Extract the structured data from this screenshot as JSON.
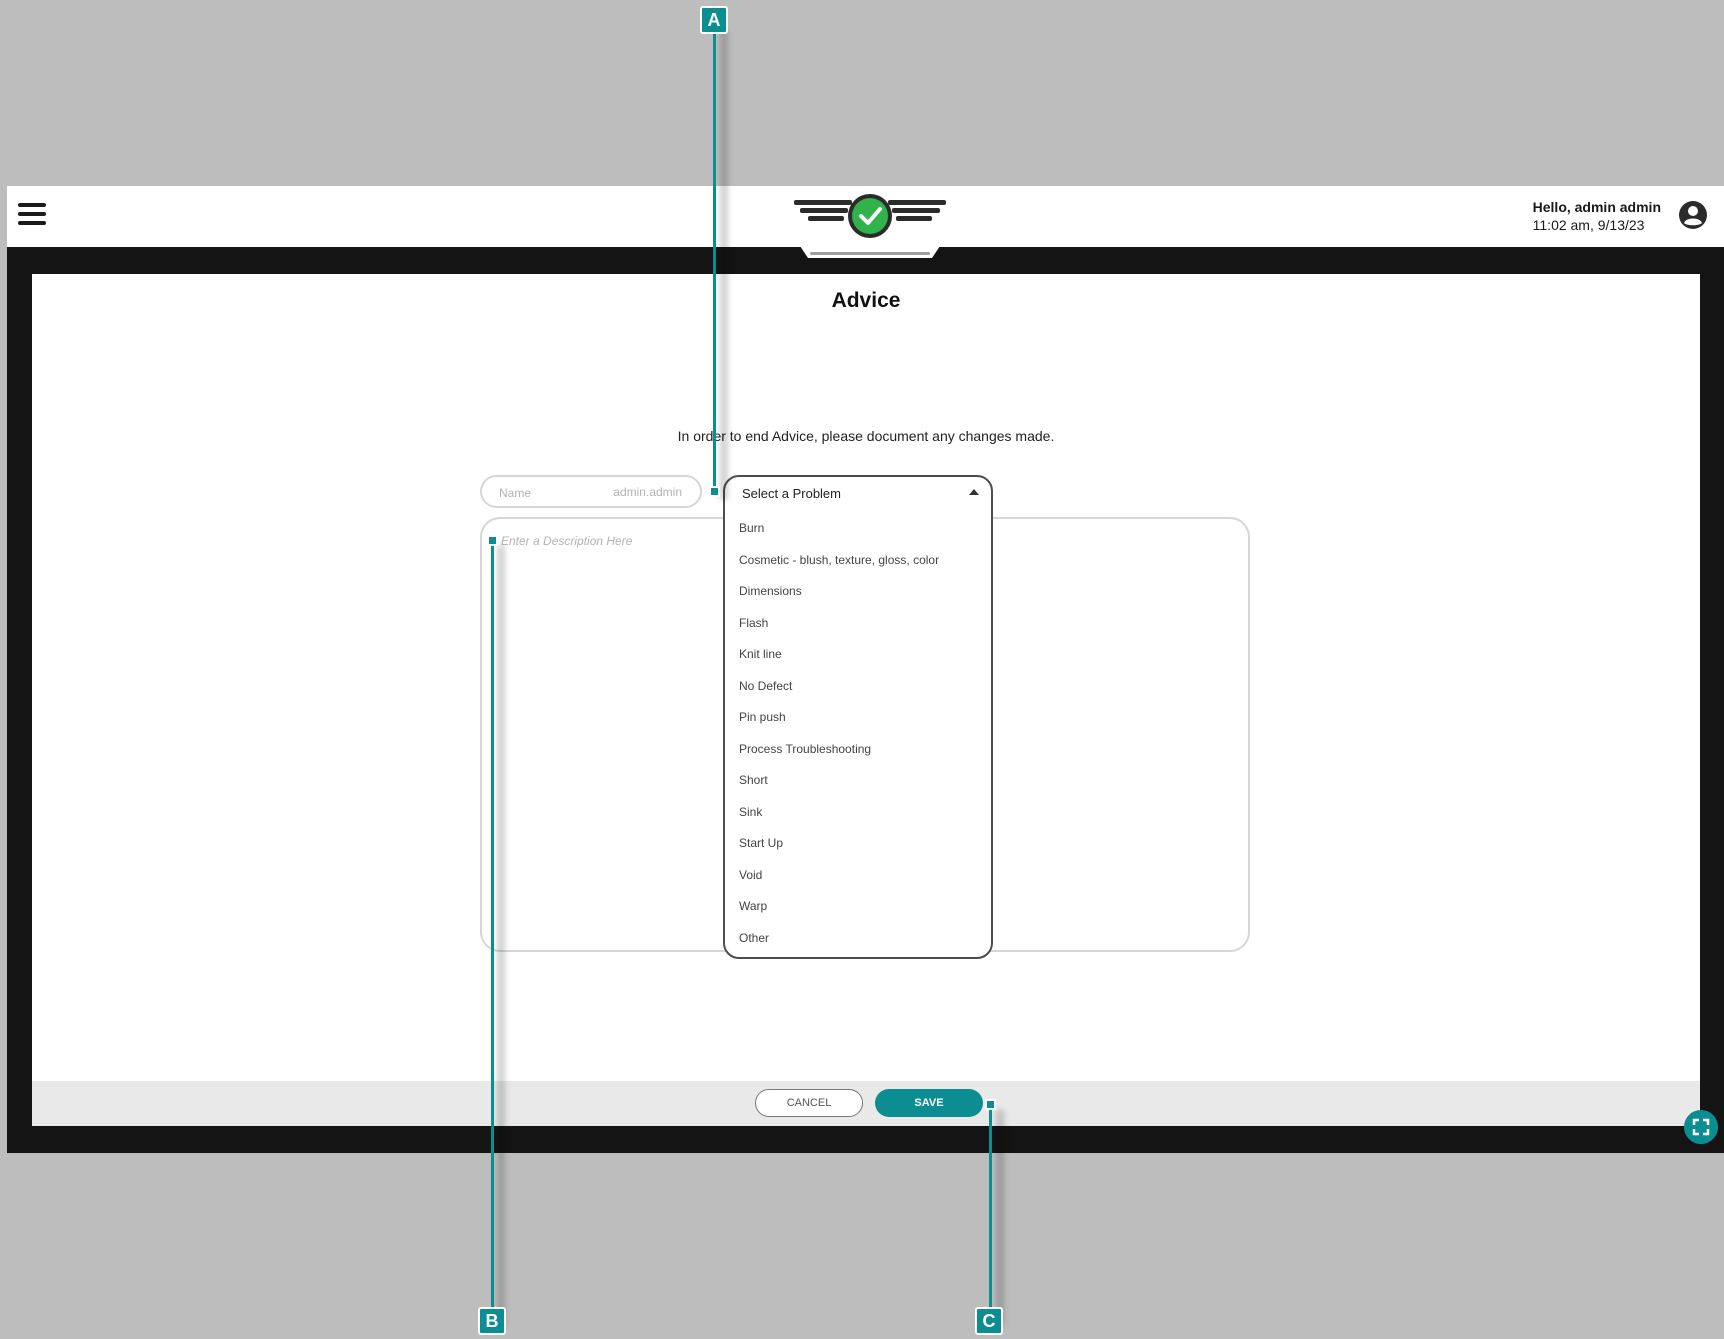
{
  "header": {
    "greeting": "Hello, admin admin",
    "datetime": "11:02 am, 9/13/23"
  },
  "dialog": {
    "title": "Advice",
    "instruction": "In order to end Advice, please document any changes made.",
    "name_label": "Name",
    "name_value": "admin.admin",
    "description_placeholder": "Enter a Description Here",
    "problem_select": {
      "label": "Select a Problem",
      "options": [
        "Burn",
        "Cosmetic - blush, texture, gloss, color",
        "Dimensions",
        "Flash",
        "Knit line",
        "No Defect",
        "Pin push",
        "Process Troubleshooting",
        "Short",
        "Sink",
        "Start Up",
        "Void",
        "Warp",
        "Other"
      ]
    },
    "cancel_label": "CANCEL",
    "save_label": "SAVE"
  },
  "callouts": {
    "a": "A",
    "b": "B",
    "c": "C"
  },
  "colors": {
    "accent": "#0b8d92",
    "logo_green": "#2fb34a",
    "frame": "#141414",
    "background": "#bdbdbd"
  }
}
